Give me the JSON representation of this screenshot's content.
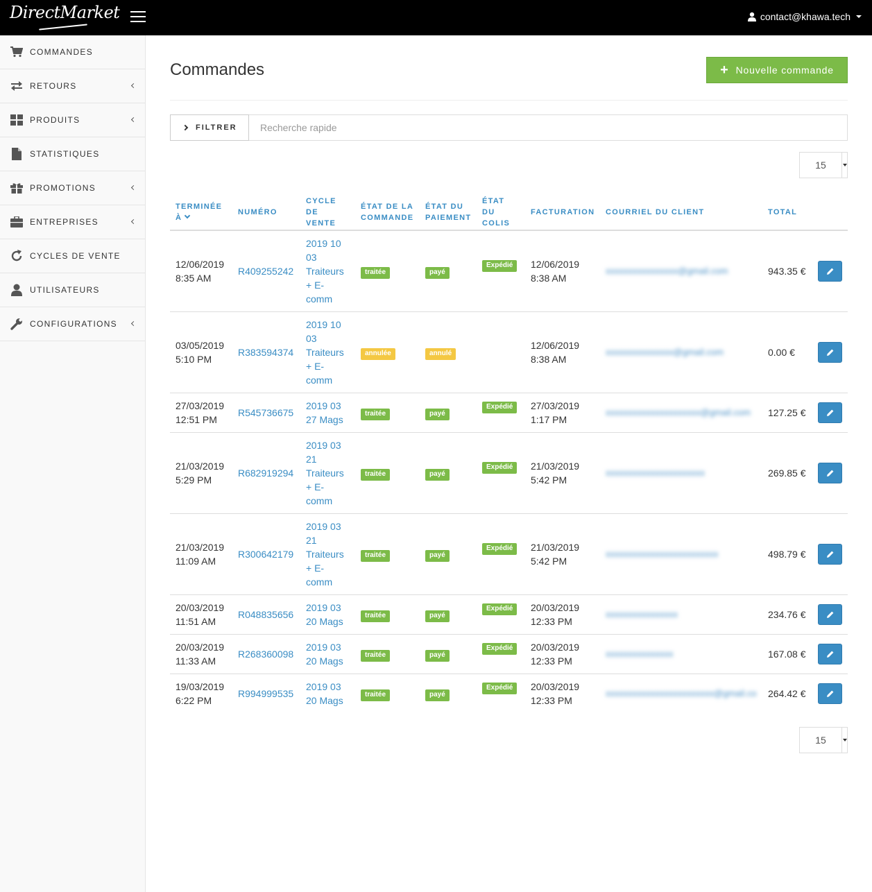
{
  "header": {
    "logo_text": "DirectMarket",
    "user_email": "contact@khawa.tech"
  },
  "sidebar": {
    "items": [
      {
        "label": "COMMANDES",
        "icon": "cart-icon",
        "has_submenu": false
      },
      {
        "label": "RETOURS",
        "icon": "exchange-icon",
        "has_submenu": true
      },
      {
        "label": "PRODUITS",
        "icon": "grid-icon",
        "has_submenu": true
      },
      {
        "label": "STATISTIQUES",
        "icon": "file-icon",
        "has_submenu": false
      },
      {
        "label": "PROMOTIONS",
        "icon": "gift-icon",
        "has_submenu": true
      },
      {
        "label": "ENTREPRISES",
        "icon": "briefcase-icon",
        "has_submenu": true
      },
      {
        "label": "CYCLES DE VENTE",
        "icon": "refresh-icon",
        "has_submenu": false
      },
      {
        "label": "UTILISATEURS",
        "icon": "user-icon",
        "has_submenu": false
      },
      {
        "label": "CONFIGURATIONS",
        "icon": "wrench-icon",
        "has_submenu": true
      }
    ]
  },
  "page": {
    "title": "Commandes",
    "new_button_label": "Nouvelle commande",
    "filter_label": "FILTRER",
    "search_placeholder": "Recherche rapide",
    "page_size": "15"
  },
  "table": {
    "headers": {
      "terminee": "TERMINÉE À",
      "numero": "NUMÉRO",
      "cycle": "CYCLE DE VENTE",
      "etat_commande": "ÉTAT DE LA COMMANDE",
      "etat_paiement": "ÉTAT DU PAIEMENT",
      "etat_colis": "ÉTAT DU COLIS",
      "facturation": "FACTURATION",
      "courriel": "COURRIEL DU CLIENT",
      "total": "TOTAL"
    },
    "rows": [
      {
        "date": "12/06/2019",
        "time": "8:35 AM",
        "numero": "R409255242",
        "cycle": "2019 10 03 Traiteurs + E-comm",
        "etat_commande": "traitée",
        "etat_paiement": "payé",
        "etat_colis": "Expédié",
        "fact_date": "12/06/2019",
        "fact_time": "8:38 AM",
        "courriel": "xxxxxxxxxxxxxxxx@gmail.com",
        "total": "943.35 €"
      },
      {
        "date": "03/05/2019",
        "time": "5:10 PM",
        "numero": "R383594374",
        "cycle": "2019 10 03 Traiteurs + E-comm",
        "etat_commande": "annulée",
        "etat_paiement": "annulé",
        "etat_colis": "",
        "fact_date": "12/06/2019",
        "fact_time": "8:38 AM",
        "courriel": "xxxxxxxxxxxxxxx@gmail.com",
        "total": "0.00 €"
      },
      {
        "date": "27/03/2019",
        "time": "12:51 PM",
        "numero": "R545736675",
        "cycle": "2019 03 27 Mags",
        "etat_commande": "traitée",
        "etat_paiement": "payé",
        "etat_colis": "Expédié",
        "fact_date": "27/03/2019",
        "fact_time": "1:17 PM",
        "courriel": "xxxxxxxxxxxxxxxxxxxxx@gmail.com",
        "total": "127.25 €"
      },
      {
        "date": "21/03/2019",
        "time": "5:29 PM",
        "numero": "R682919294",
        "cycle": "2019 03 21 Traiteurs + E-comm",
        "etat_commande": "traitée",
        "etat_paiement": "payé",
        "etat_colis": "Expédié",
        "fact_date": "21/03/2019",
        "fact_time": "5:42 PM",
        "courriel": "xxxxxxxxxxxxxxxxxxxxxx",
        "total": "269.85 €"
      },
      {
        "date": "21/03/2019",
        "time": "11:09 AM",
        "numero": "R300642179",
        "cycle": "2019 03 21 Traiteurs + E-comm",
        "etat_commande": "traitée",
        "etat_paiement": "payé",
        "etat_colis": "Expédié",
        "fact_date": "21/03/2019",
        "fact_time": "5:42 PM",
        "courriel": "xxxxxxxxxxxxxxxxxxxxxxxxx",
        "total": "498.79 €"
      },
      {
        "date": "20/03/2019",
        "time": "11:51 AM",
        "numero": "R048835656",
        "cycle": "2019 03 20 Mags",
        "etat_commande": "traitée",
        "etat_paiement": "payé",
        "etat_colis": "Expédié",
        "fact_date": "20/03/2019",
        "fact_time": "12:33 PM",
        "courriel": "xxxxxxxxxxxxxxxx",
        "total": "234.76 €"
      },
      {
        "date": "20/03/2019",
        "time": "11:33 AM",
        "numero": "R268360098",
        "cycle": "2019 03 20 Mags",
        "etat_commande": "traitée",
        "etat_paiement": "payé",
        "etat_colis": "Expédié",
        "fact_date": "20/03/2019",
        "fact_time": "12:33 PM",
        "courriel": "xxxxxxxxxxxxxxx",
        "total": "167.08 €"
      },
      {
        "date": "19/03/2019",
        "time": "6:22 PM",
        "numero": "R994999535",
        "cycle": "2019 03 20 Mags",
        "etat_commande": "traitée",
        "etat_paiement": "payé",
        "etat_colis": "Expédié",
        "fact_date": "20/03/2019",
        "fact_time": "12:33 PM",
        "courriel": "xxxxxxxxxxxxxxxxxxxxxxxx@gmail.com",
        "total": "264.42 €"
      }
    ]
  },
  "colors": {
    "topbar": "#000000",
    "accent_blue": "#3a8dc4",
    "success_green": "#7cbb48",
    "warning_yellow": "#f4c843",
    "sidebar_bg": "#f9f9f9"
  }
}
